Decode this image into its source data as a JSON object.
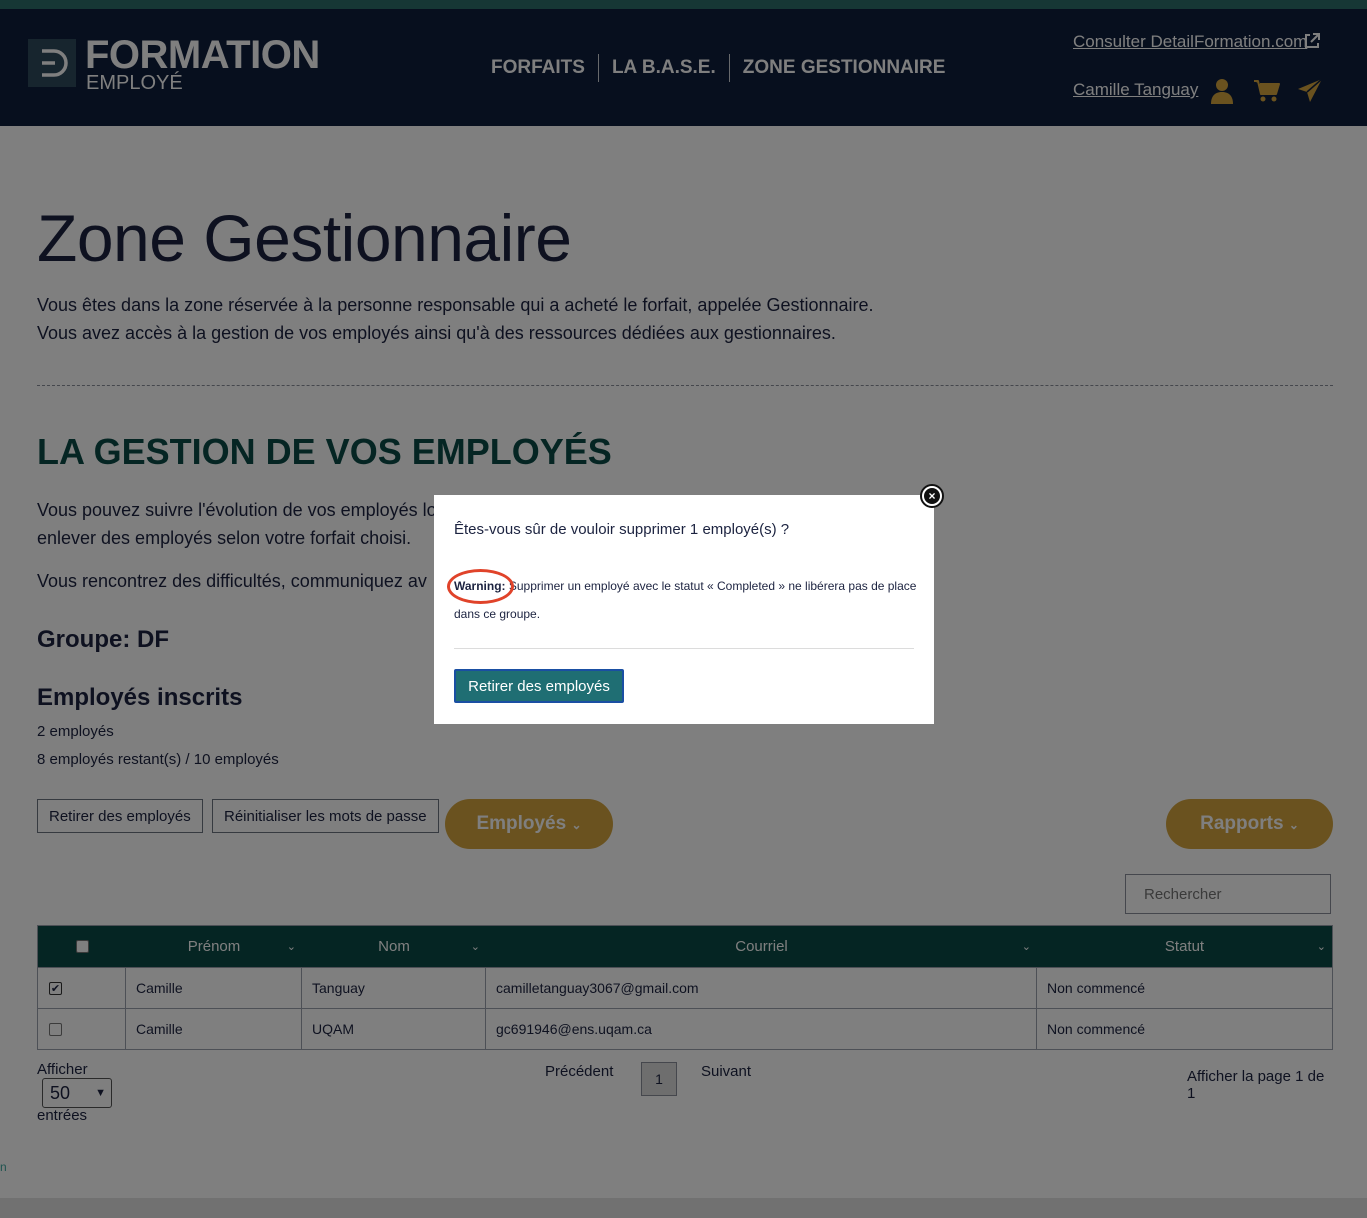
{
  "header": {
    "logo_main": "FORMATION",
    "logo_sub": "EMPLOYÉ",
    "nav": [
      "FORFAITS",
      "LA B.A.S.E.",
      "ZONE GESTIONNAIRE"
    ],
    "external_link": "Consulter DetailFormation.com",
    "user_name": "Camille Tanguay",
    "icons": [
      "external-link-icon",
      "user-icon",
      "cart-icon",
      "send-icon"
    ]
  },
  "page": {
    "title": "Zone Gestionnaire",
    "desc_line1": "Vous êtes dans la zone réservée à la personne responsable qui a acheté le forfait, appelée Gestionnaire.",
    "desc_line2": "Vous avez accès à la gestion de vos employés ainsi qu'à des ressources dédiées aux gestionnaires.",
    "section_title": "LA GESTION DE VOS EMPLOYÉS",
    "para1_line1": "Vous pouvez suivre l'évolution de vos employés lo",
    "para1_line2": "enlever des employés selon votre forfait choisi.",
    "para2": "Vous rencontrez des difficultés, communiquez av",
    "group_label": "Groupe: DF",
    "enrolled_title": "Employés inscrits",
    "employee_count": "2 employés",
    "remaining": "8 employés restant(s) / 10 employés"
  },
  "actions": {
    "remove_label": "Retirer des employés",
    "reset_label": "Réinitialiser les mots de passe",
    "employees_dropdown": "Employés",
    "reports_dropdown": "Rapports",
    "search_placeholder": "Rechercher"
  },
  "table": {
    "columns": [
      "Prénom",
      "Nom",
      "Courriel",
      "Statut"
    ],
    "rows": [
      {
        "checked": true,
        "prenom": "Camille",
        "nom": "Tanguay",
        "courriel": "camilletanguay3067@gmail.com",
        "statut": "Non commencé"
      },
      {
        "checked": false,
        "prenom": "Camille",
        "nom": "UQAM",
        "courriel": "gc691946@ens.uqam.ca",
        "statut": "Non commencé"
      }
    ]
  },
  "pagination": {
    "show_label": "Afficher",
    "entries_value": "50",
    "entries_label": "entrées",
    "prev": "Précédent",
    "current_page": "1",
    "next": "Suivant",
    "page_info": "Afficher la page 1 de 1"
  },
  "footer": {
    "fragment": "n"
  },
  "modal": {
    "question": "Êtes-vous sûr de vouloir supprimer 1 employé(s) ?",
    "warning_label": "Warning:",
    "warning_text": " Supprimer un employé avec le statut « Completed » ne libérera pas de place dans ce groupe.",
    "confirm_button": "Retirer des employés",
    "close_symbol": "×"
  },
  "colors": {
    "header_bg": "#0f1f3d",
    "accent_gold": "#d4a43e",
    "teal": "#0b4b47",
    "modal_button": "#1f6e73",
    "annotation_red": "#e0432a"
  }
}
